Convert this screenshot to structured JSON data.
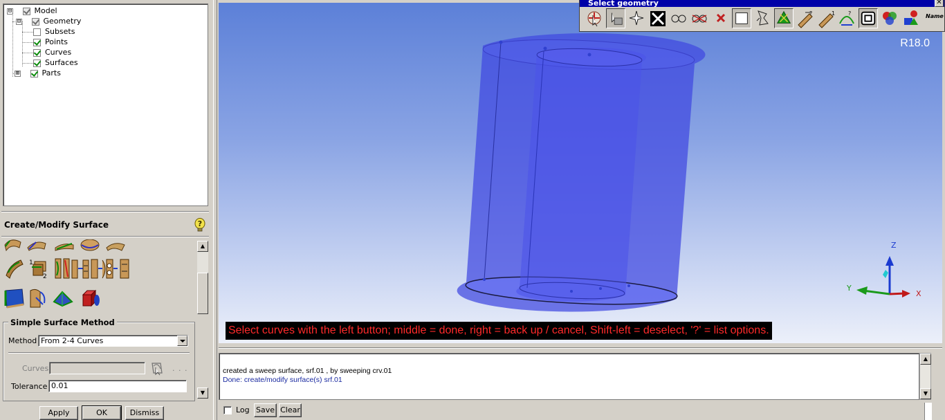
{
  "tree": {
    "items": [
      {
        "label": "Model",
        "expander": "⊟",
        "checkbox": "grey"
      },
      {
        "label": "Geometry",
        "expander": "⊟",
        "checkbox": "grey"
      },
      {
        "label": "Subsets",
        "checkbox": "unchecked"
      },
      {
        "label": "Points",
        "checkbox": "checked"
      },
      {
        "label": "Curves",
        "checkbox": "checked"
      },
      {
        "label": "Surfaces",
        "checkbox": "checked"
      },
      {
        "label": "Parts",
        "expander": "⊞",
        "checkbox": "checked"
      }
    ]
  },
  "panel": {
    "title": "Create/Modify Surface",
    "help_icon": "help-question-icon",
    "tool_icons": [
      "surface-from-curves-icon",
      "curve-mesh-icon",
      "sweep-surface-icon",
      "revolve-icon",
      "loft-icon",
      "offset-surface-icon",
      "extend-surface-icon",
      "trim-surface-icon",
      "segment-surface-icon",
      "merge-surfaces-icon",
      "untrim-surface-icon",
      "restore-dormant-icon",
      "midsurface-icon",
      "fill-icon",
      "convert-surface-icon",
      "standard-shapes-icon"
    ]
  },
  "method_group": {
    "legend": "Simple Surface Method",
    "method_label": "Method",
    "method_value": "From 2-4 Curves",
    "curves_label": "Curves",
    "curves_value": "",
    "curves_dots": ". . .",
    "tolerance_label": "Tolerance",
    "tolerance_value": "0.01"
  },
  "buttons": {
    "apply": "Apply",
    "ok": "OK",
    "dismiss": "Dismiss"
  },
  "viewport": {
    "version": "R18.0",
    "prompt": "Select curves with the left button; middle = done, right = back up / cancel, Shift-left = deselect, '?' = list options.",
    "axes": {
      "z": "Z",
      "y": "Y",
      "x": "X"
    }
  },
  "select_geometry": {
    "title": "Select geometry",
    "close": "✕",
    "name_label": "Name",
    "tools": [
      "select-items-icon",
      "toggle-dynamic-icon",
      "select-all-icon",
      "cancel-selection-icon",
      "show-selected-icon",
      "hide-selected-icon",
      "deselect-icon",
      "box-select-icon",
      "polygon-select-icon",
      "select-visible-icon",
      "select-by-part-icon",
      "select-by-property-icon",
      "select-by-curvature-icon",
      "select-by-entity-icon",
      "color-select-icon",
      "select-by-type-icon",
      "select-by-name-icon"
    ]
  },
  "messages": {
    "lines": [
      "created a sweep surface, srf.01 , by sweeping crv.01",
      "Done: create/modify surface(s) srf.01"
    ],
    "log_label": "Log",
    "save_label": "Save",
    "clear_label": "Clear"
  }
}
